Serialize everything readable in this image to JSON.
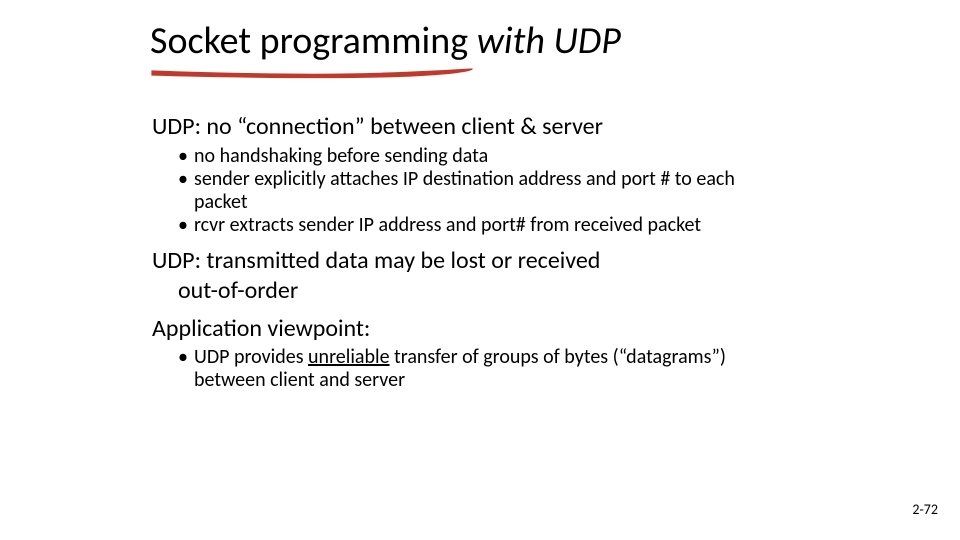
{
  "title_part1": "Socket programming ",
  "title_part2": "with UDP",
  "section1": {
    "heading_pre": "UDP: no ",
    "heading_quote": "“connection”",
    "heading_post": " between client & server",
    "bullets": [
      "no handshaking before sending data",
      "sender explicitly attaches IP destination address and port # to each packet",
      "rcvr extracts sender IP address and port# from received packet"
    ]
  },
  "section2": {
    "line1": "UDP: transmitted data may be lost or received",
    "line2": "out-of-order"
  },
  "section3": {
    "heading": "Application viewpoint:",
    "bullet_pre": "UDP provides ",
    "bullet_underlined": "unreliable",
    "bullet_mid": " transfer  of groups of bytes (",
    "bullet_quote": "“datagrams”",
    "bullet_post": ")  between client and server"
  },
  "footer": "2-72"
}
